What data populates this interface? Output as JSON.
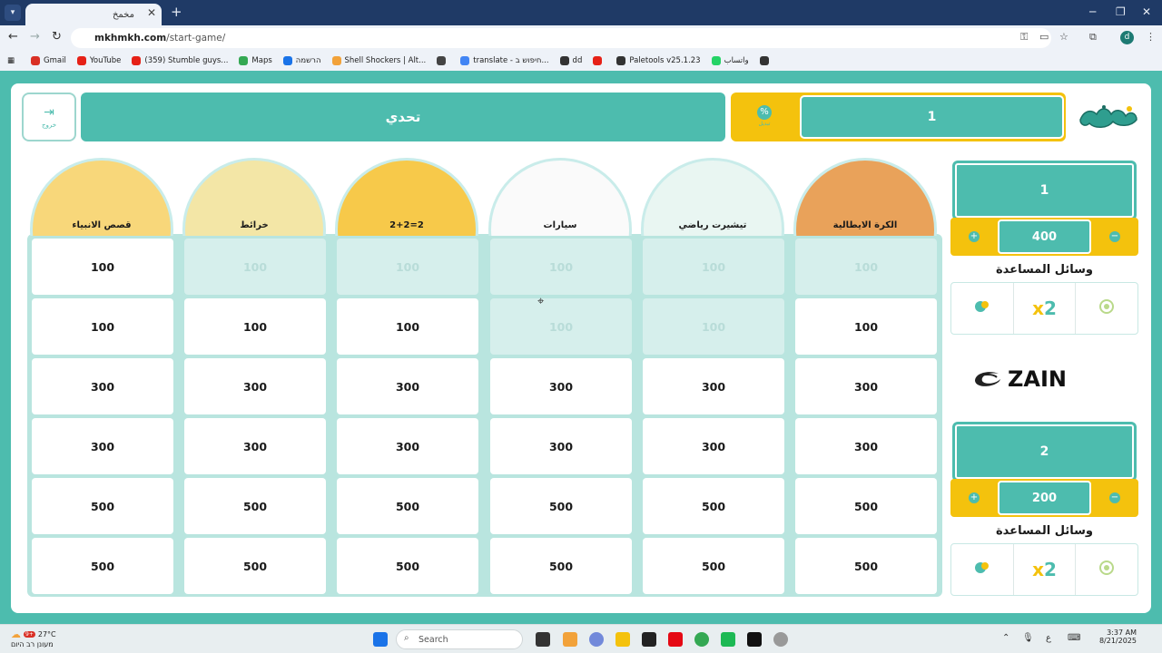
{
  "browser": {
    "tab_title": "مخمخ",
    "url_host": "mkhmkh.com",
    "url_path": "/start-game/",
    "profile_initial": "d",
    "bookmarks": [
      {
        "label": "Gmail",
        "color": "#d93025"
      },
      {
        "label": "YouTube",
        "color": "#e62117"
      },
      {
        "label": "(359) Stumble guys...",
        "color": "#e62117"
      },
      {
        "label": "Maps",
        "color": "#34a853"
      },
      {
        "label": "הרשמה",
        "color": "#1a73e8"
      },
      {
        "label": "Shell Shockers | Alt...",
        "color": "#f2a23a"
      },
      {
        "label": "",
        "color": "#444444"
      },
      {
        "label": "translate - חיפוש ב...",
        "color": "#4285f4"
      },
      {
        "label": "dd",
        "color": "#333333"
      },
      {
        "label": "",
        "color": "#e62117"
      },
      {
        "label": "Paletools v25.1.23",
        "color": "#333333"
      },
      {
        "label": "واتساب",
        "color": "#25d366"
      },
      {
        "label": "",
        "color": "#333333"
      }
    ]
  },
  "header": {
    "exit_label": "خروج",
    "challenge_label": "تحدي",
    "turn_icon_label": "تبديل",
    "current_turn": "1"
  },
  "categories": [
    {
      "name": "قصص الانبياء",
      "color": "#f8d77a"
    },
    {
      "name": "خرائط",
      "color": "#f3e6a6"
    },
    {
      "name": "2+2=2",
      "color": "#f7c94a"
    },
    {
      "name": "سيارات",
      "color": "#fafafa"
    },
    {
      "name": "تيشيرت رياضي",
      "color": "#e9f6f2"
    },
    {
      "name": "الكرة الايطالية",
      "color": "#e9a25a"
    }
  ],
  "board": {
    "rows": [
      [
        {
          "v": "100",
          "used": false
        },
        {
          "v": "100",
          "used": true
        },
        {
          "v": "100",
          "used": true
        },
        {
          "v": "100",
          "used": true
        },
        {
          "v": "100",
          "used": true
        },
        {
          "v": "100",
          "used": true
        }
      ],
      [
        {
          "v": "100",
          "used": false
        },
        {
          "v": "100",
          "used": false
        },
        {
          "v": "100",
          "used": false
        },
        {
          "v": "100",
          "used": true
        },
        {
          "v": "100",
          "used": true
        },
        {
          "v": "100",
          "used": false
        }
      ],
      [
        {
          "v": "300",
          "used": false
        },
        {
          "v": "300",
          "used": false
        },
        {
          "v": "300",
          "used": false
        },
        {
          "v": "300",
          "used": false
        },
        {
          "v": "300",
          "used": false
        },
        {
          "v": "300",
          "used": false
        }
      ],
      [
        {
          "v": "300",
          "used": false
        },
        {
          "v": "300",
          "used": false
        },
        {
          "v": "300",
          "used": false
        },
        {
          "v": "300",
          "used": false
        },
        {
          "v": "300",
          "used": false
        },
        {
          "v": "300",
          "used": false
        }
      ],
      [
        {
          "v": "500",
          "used": false
        },
        {
          "v": "500",
          "used": false
        },
        {
          "v": "500",
          "used": false
        },
        {
          "v": "500",
          "used": false
        },
        {
          "v": "500",
          "used": false
        },
        {
          "v": "500",
          "used": false
        }
      ],
      [
        {
          "v": "500",
          "used": false
        },
        {
          "v": "500",
          "used": false
        },
        {
          "v": "500",
          "used": false
        },
        {
          "v": "500",
          "used": false
        },
        {
          "v": "500",
          "used": false
        },
        {
          "v": "500",
          "used": false
        }
      ]
    ]
  },
  "teams": [
    {
      "name": "1",
      "score": "400",
      "help_title": "وسائل المساعدة"
    },
    {
      "name": "2",
      "score": "200",
      "help_title": "وسائل المساعدة"
    }
  ],
  "sponsor": "ZAIN",
  "taskbar": {
    "temperature": "27°C",
    "weather_text": "מעונן רב היום",
    "search_placeholder": "Search",
    "time": "3:37 AM",
    "date": "8/21/2025",
    "notification_count": "9+"
  },
  "colors": {
    "accent": "#4dbcae",
    "yellow": "#f4c20d",
    "used_cell": "#d6efec"
  }
}
